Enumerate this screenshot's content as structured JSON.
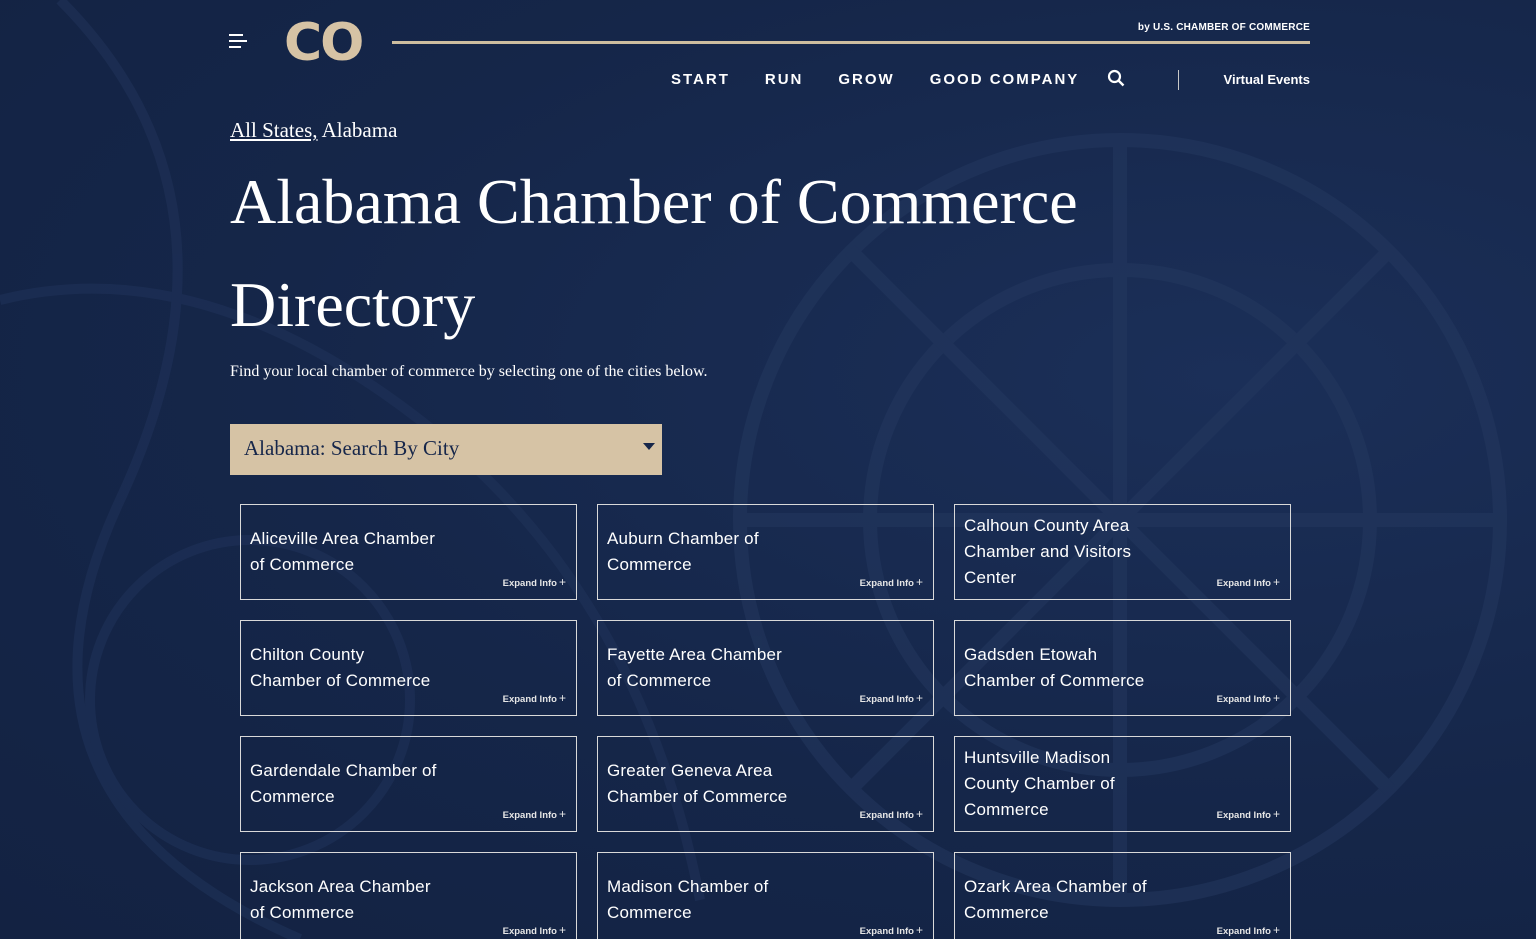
{
  "header": {
    "logo": "CO",
    "by_line": "by U.S. CHAMBER OF COMMERCE",
    "nav": [
      "START",
      "RUN",
      "GROW",
      "GOOD COMPANY"
    ],
    "virtual_events": "Virtual Events",
    "icons": {
      "menu": "menu-icon",
      "search": "search-icon"
    }
  },
  "breadcrumb": {
    "all_states": "All States,",
    "current": "Alabama"
  },
  "page_title": "Alabama Chamber of Commerce Directory",
  "intro": "Find your local chamber of commerce by selecting one of the cities below.",
  "city_select": {
    "label": "Alabama: Search By City"
  },
  "expand_label": "Expand Info",
  "chambers": [
    "Aliceville Area Chamber of Commerce",
    "Auburn Chamber of Commerce",
    "Calhoun County Area Chamber and Visitors Center",
    "Chilton County Chamber of Commerce",
    "Fayette Area Chamber of Commerce",
    "Gadsden Etowah Chamber of Commerce",
    "Gardendale Chamber of Commerce",
    "Greater Geneva Area Chamber of Commerce",
    "Huntsville Madison County Chamber of Commerce",
    "Jackson Area Chamber of Commerce",
    "Madison Chamber of Commerce",
    "Ozark Area Chamber of Commerce"
  ],
  "colors": {
    "background": "#15264a",
    "accent": "#d6c3a5",
    "text": "#ffffff"
  }
}
